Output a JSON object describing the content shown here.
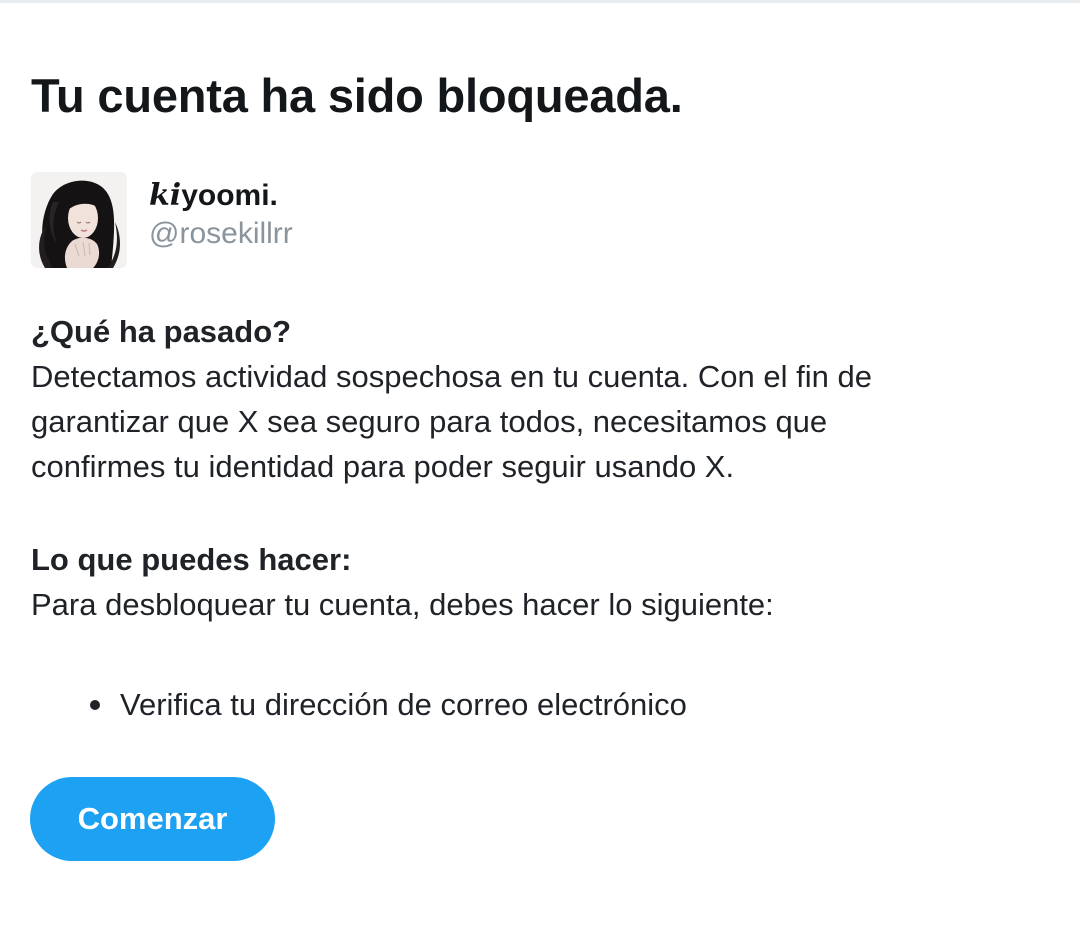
{
  "page": {
    "title": "Tu cuenta ha sido bloqueada."
  },
  "profile": {
    "display_name_prefix": "ki",
    "display_name_rest": "yoomi.",
    "handle": "@rosekillrr",
    "avatar_icon": "profile-photo-avatar"
  },
  "what_happened": {
    "heading": "¿Qué ha pasado?",
    "body_lines": [
      "Detectamos actividad sospechosa en tu cuenta. Con el fin de",
      "garantizar que X sea seguro para todos, necesitamos que",
      "confirmes tu identidad para poder seguir usando X."
    ]
  },
  "what_you_can_do": {
    "heading": "Lo que puedes hacer:",
    "body": "Para desbloquear tu cuenta, debes hacer lo siguiente:",
    "steps": [
      "Verifica tu dirección de correo electrónico"
    ]
  },
  "actions": {
    "start_label": "Comenzar"
  },
  "colors": {
    "accent": "#1da1f2",
    "handle_gray": "#8a949c",
    "text": "#1f2328"
  }
}
